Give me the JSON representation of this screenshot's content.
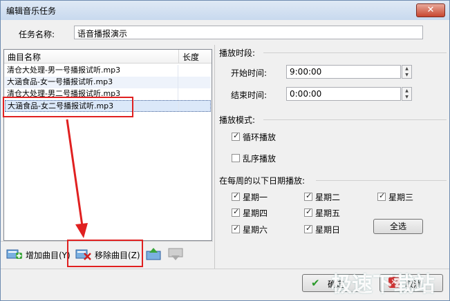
{
  "window": {
    "title": "编辑音乐任务",
    "close_glyph": "✕"
  },
  "task": {
    "label": "任务名称:",
    "value": "语音播报演示"
  },
  "playlist": {
    "columns": [
      "曲目名称",
      "长度"
    ],
    "items": [
      {
        "name": "清仓大处理-男一号播报试听.mp3",
        "length": ""
      },
      {
        "name": "大涵食品-女一号播报试听.mp3",
        "length": ""
      },
      {
        "name": "清仓大处理-男二号播报试听.mp3",
        "length": ""
      },
      {
        "name": "大涵食品-女二号播报试听.mp3",
        "length": ""
      }
    ]
  },
  "toolbar": {
    "add_label": "增加曲目(Y)",
    "remove_label": "移除曲目(Z)"
  },
  "schedule": {
    "title": "播放时段:",
    "start_label": "开始时间:",
    "start_value": "9:00:00",
    "end_label": "结束时间:",
    "end_value": "0:00:00"
  },
  "mode": {
    "title": "播放模式:",
    "loop_label": "循环播放",
    "loop_checked": true,
    "shuffle_label": "乱序播放",
    "shuffle_checked": false
  },
  "days": {
    "title": "在每周的以下日期播放:",
    "items": [
      "星期一",
      "星期二",
      "星期三",
      "星期四",
      "星期五",
      "星期六",
      "星期日"
    ],
    "select_all_label": "全选"
  },
  "footer": {
    "ok_label": "确定",
    "cancel_label": "取消"
  },
  "watermark": "极速下载站",
  "colors": {
    "annotation_red": "#e02020",
    "title_bar": "#c8d9ee",
    "selection": "#dbe8f9"
  }
}
